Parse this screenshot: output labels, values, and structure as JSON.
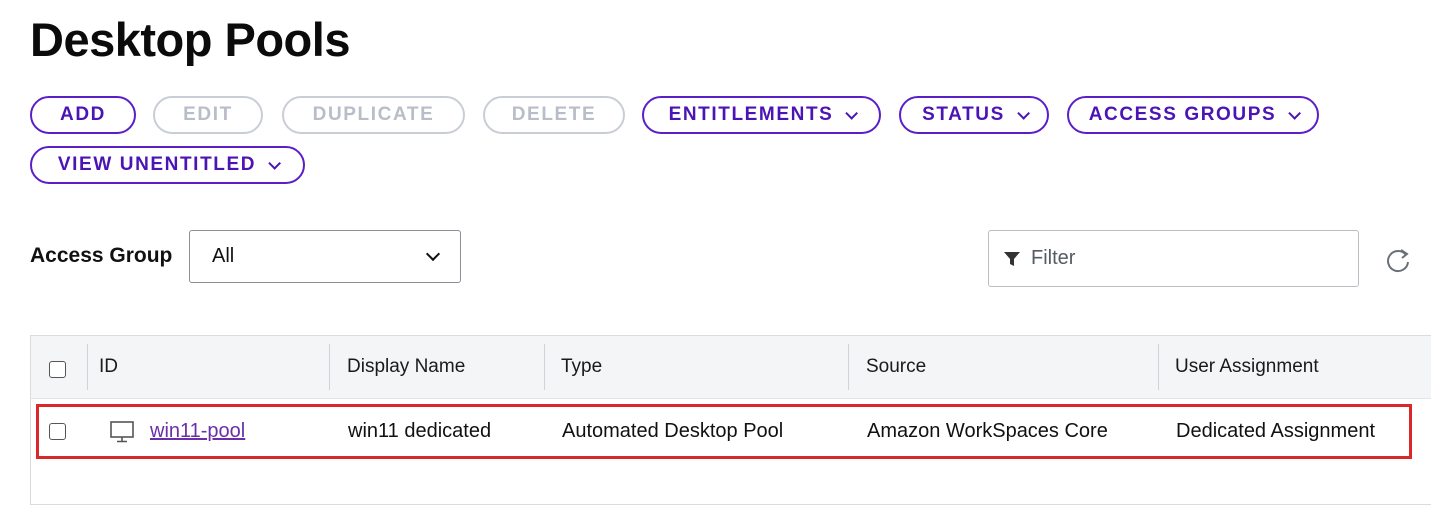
{
  "page": {
    "title": "Desktop Pools"
  },
  "toolbar": {
    "add": "ADD",
    "edit": "EDIT",
    "duplicate": "DUPLICATE",
    "delete": "DELETE",
    "entitlements": "ENTITLEMENTS",
    "status": "STATUS",
    "access_groups": "ACCESS GROUPS",
    "view_unentitled": "VIEW UNENTITLED"
  },
  "access_group": {
    "label": "Access Group",
    "selected": "All"
  },
  "filter": {
    "placeholder": "Filter"
  },
  "table": {
    "columns": [
      "ID",
      "Display Name",
      "Type",
      "Source",
      "User Assignment"
    ],
    "rows": [
      {
        "id": "win11-pool",
        "display_name": "win11 dedicated",
        "type": "Automated Desktop Pool",
        "source": "Amazon WorkSpaces Core",
        "user_assignment": "Dedicated Assignment"
      }
    ]
  },
  "colors": {
    "accent": "#5b1fc7",
    "disabled": "#c9cdd6",
    "highlight": "#d8282a",
    "link": "#6a2fa8"
  },
  "icons": {
    "dropdown": "chevron-down-icon",
    "filter": "filter-icon",
    "refresh": "refresh-icon",
    "desktop": "monitor-icon"
  }
}
